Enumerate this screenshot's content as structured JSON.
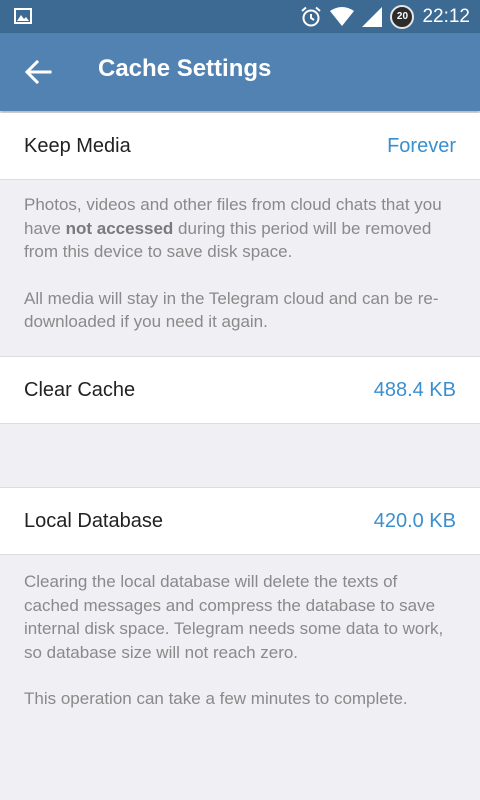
{
  "status_bar": {
    "time": "22:12",
    "notification_badge": "20",
    "icons": [
      "image-icon",
      "alarm-icon",
      "wifi-icon",
      "signal-icon"
    ]
  },
  "app_bar": {
    "title": "Cache Settings",
    "back_icon": "arrow-back-icon"
  },
  "keep_media": {
    "label": "Keep Media",
    "value": "Forever"
  },
  "keep_media_info": {
    "p1_before": "Photos, videos and other files from cloud chats that you have ",
    "p1_bold": "not accessed",
    "p1_after": " during this period will be removed from this device to save disk space.",
    "p2": "All media will stay in the Telegram cloud and can be re-downloaded if you need it again."
  },
  "clear_cache": {
    "label": "Clear Cache",
    "value": "488.4 KB"
  },
  "local_database": {
    "label": "Local Database",
    "value": "420.0 KB"
  },
  "database_info": {
    "p1": "Clearing the local database will delete the texts of cached messages and compress the database to save internal disk space. Telegram needs some data to work, so database size will not reach zero.",
    "p2": "This operation can take a few minutes to complete."
  },
  "colors": {
    "status_bar": "#3c6a92",
    "app_bar": "#5282b1",
    "accent_value": "#3a8fd0",
    "background": "#efeff4",
    "info_text": "#8a8a8a"
  }
}
